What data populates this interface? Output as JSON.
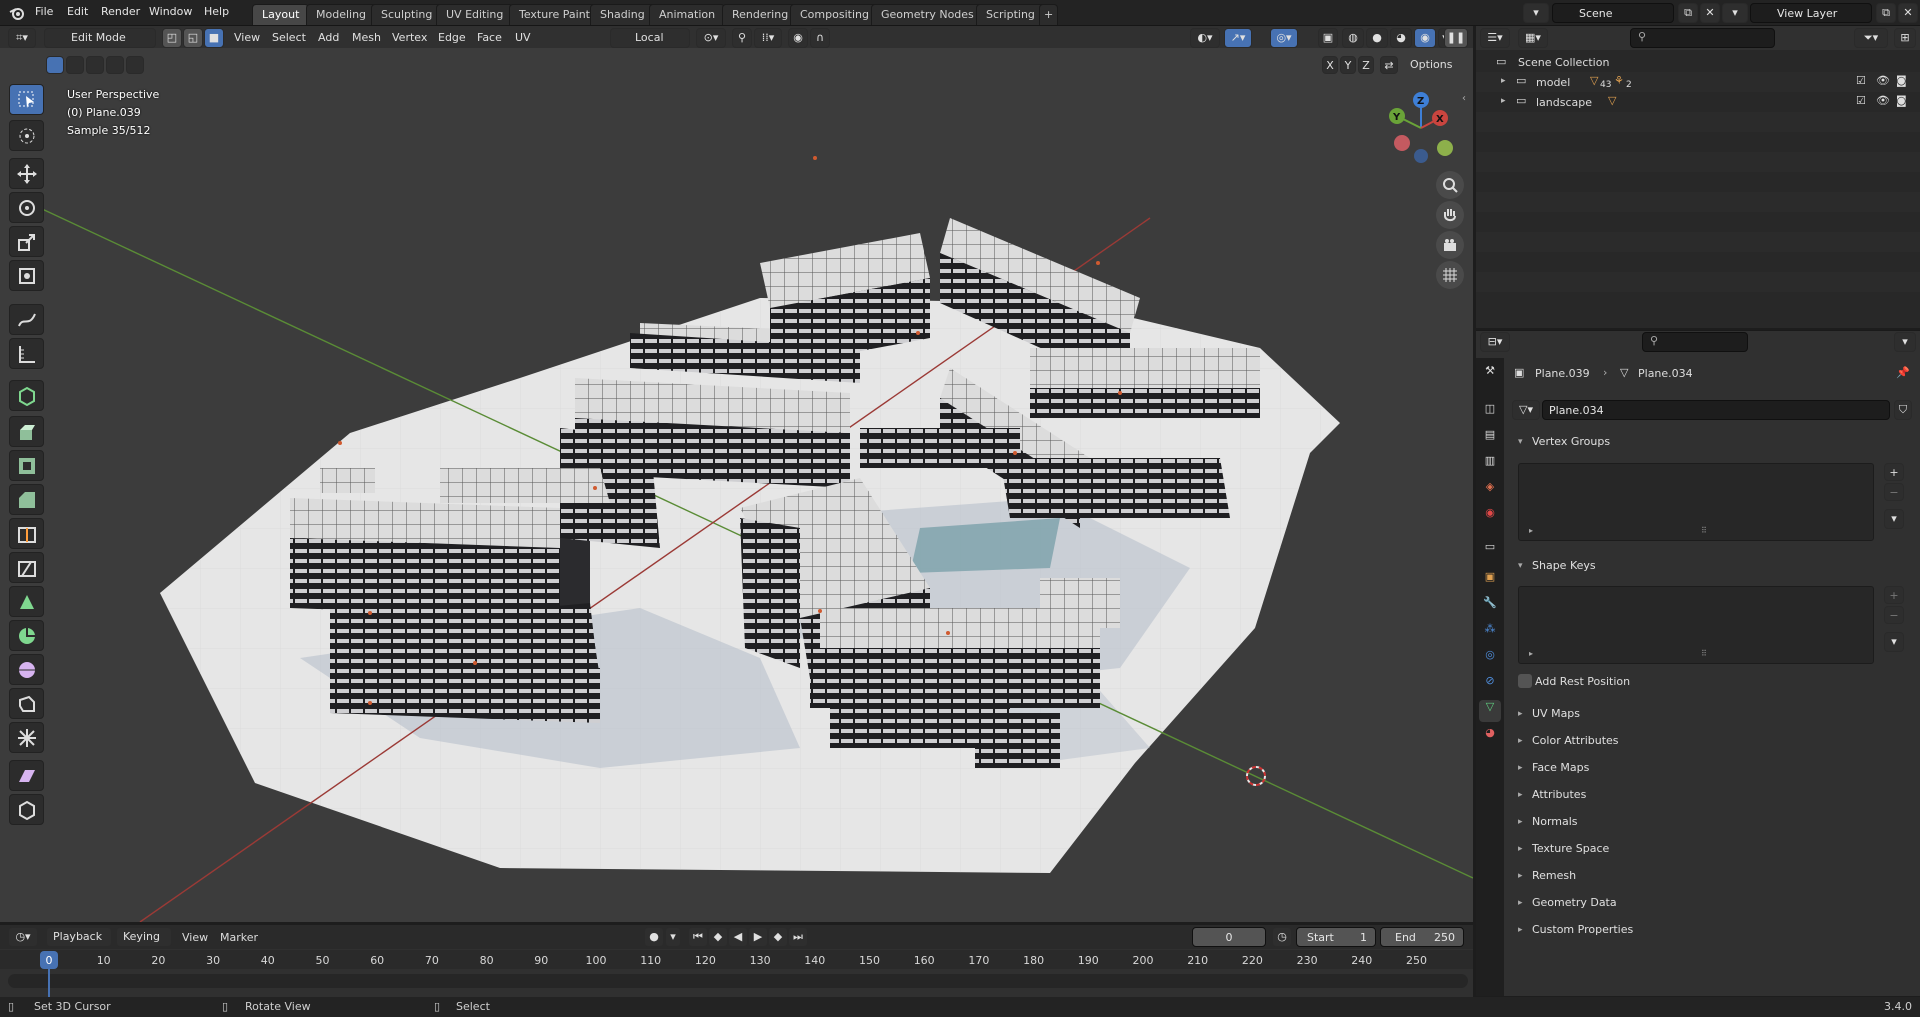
{
  "top_menu": [
    "File",
    "Edit",
    "Render",
    "Window",
    "Help"
  ],
  "workspaces": [
    "Layout",
    "Modeling",
    "Sculpting",
    "UV Editing",
    "Texture Paint",
    "Shading",
    "Animation",
    "Rendering",
    "Compositing",
    "Geometry Nodes",
    "Scripting"
  ],
  "active_workspace": "Layout",
  "scene": {
    "label": "Scene",
    "view_layer": "View Layer"
  },
  "viewport_header": {
    "mode": "Edit Mode",
    "menus": [
      "View",
      "Select",
      "Add",
      "Mesh",
      "Vertex",
      "Edge",
      "Face",
      "UV"
    ],
    "orientation": "Local",
    "options": "Options",
    "axes": [
      "X",
      "Y",
      "Z"
    ]
  },
  "overlay_text": {
    "line1": "User Perspective",
    "line2": "(0) Plane.039",
    "line3": "Sample 35/512"
  },
  "gizmo": {
    "x": "X",
    "y": "Y",
    "z": "Z"
  },
  "outliner": {
    "root": "Scene Collection",
    "items": [
      {
        "name": "model",
        "badge1": "43",
        "badge2": "2"
      },
      {
        "name": "landscape"
      }
    ]
  },
  "properties": {
    "breadcrumb_object": "Plane.039",
    "breadcrumb_mesh": "Plane.034",
    "mesh_name": "Plane.034",
    "vertex_groups": "Vertex Groups",
    "shape_keys": "Shape Keys",
    "add_rest_position": "Add Rest Position",
    "collapsed": [
      "UV Maps",
      "Color Attributes",
      "Face Maps",
      "Attributes",
      "Normals",
      "Texture Space",
      "Remesh",
      "Geometry Data",
      "Custom Properties"
    ]
  },
  "timeline": {
    "menus": [
      "Playback",
      "Keying",
      "View",
      "Marker"
    ],
    "current_frame": "0",
    "start_label": "Start",
    "start": "1",
    "end_label": "End",
    "end": "250",
    "ticks": [
      "0",
      "10",
      "20",
      "30",
      "40",
      "50",
      "60",
      "70",
      "80",
      "90",
      "100",
      "110",
      "120",
      "130",
      "140",
      "150",
      "160",
      "170",
      "180",
      "190",
      "200",
      "210",
      "220",
      "230",
      "240",
      "250"
    ]
  },
  "statusbar": {
    "hint1": "Set 3D Cursor",
    "hint2": "Rotate View",
    "hint3": "Select",
    "version": "3.4.0"
  },
  "colors": {
    "accent": "#4772b3",
    "x_axis": "#c9453f",
    "y_axis": "#6aa338",
    "z_axis": "#3e7fd6"
  }
}
